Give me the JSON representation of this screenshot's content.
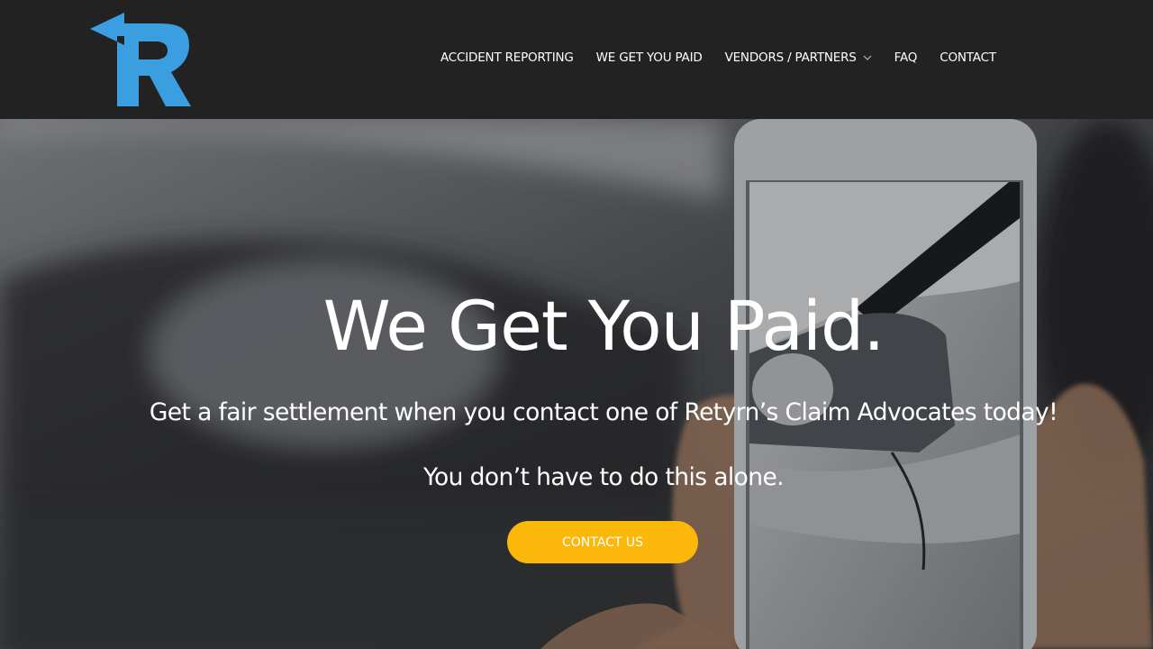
{
  "brand": {
    "logo_icon": "retyrn-r-arrow-logo",
    "logo_color": "#3b9ee0"
  },
  "nav": {
    "items": [
      {
        "label": "ACCIDENT REPORTING"
      },
      {
        "label": "WE GET YOU PAID"
      },
      {
        "label": "VENDORS / PARTNERS",
        "icon": "chevron-down-icon"
      },
      {
        "label": "FAQ"
      },
      {
        "label": "CONTACT"
      }
    ]
  },
  "hero": {
    "title": "We Get You Paid.",
    "subtitle": "Get a fair settlement when you contact one of Retyrn’s Claim Advocates today!",
    "tagline": "You don’t have to do this alone.",
    "cta_label": "CONTACT US",
    "cta_color": "#fbb80a",
    "background": "photo of hand holding smartphone photographing damaged car headlight"
  },
  "colors": {
    "header_bg": "#222222",
    "text": "#ffffff"
  }
}
